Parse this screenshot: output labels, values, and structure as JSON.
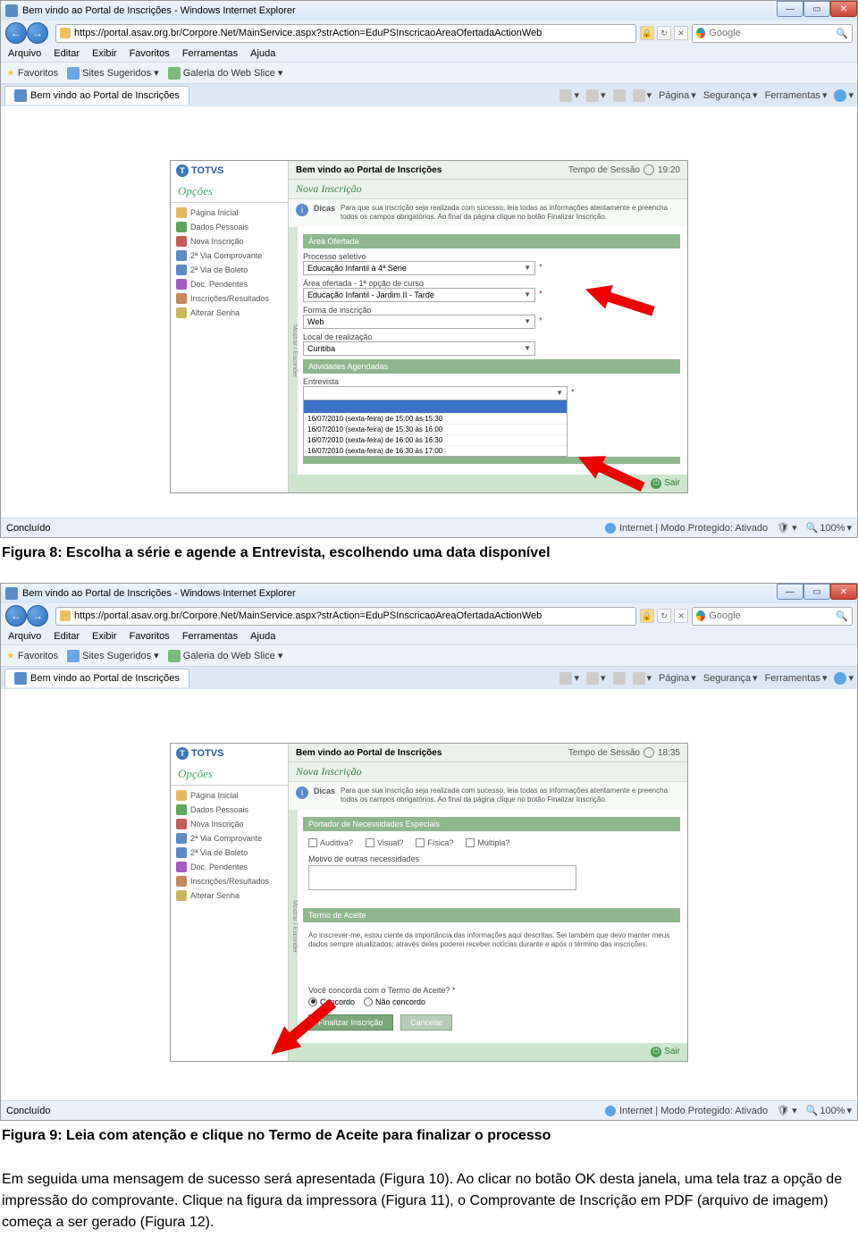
{
  "fig8": {
    "browser": {
      "title": "Bem vindo ao Portal de Inscrições - Windows Internet Explorer",
      "url": "https://portal.asav.org.br/Corpore.Net/MainService.aspx?strAction=EduPSInscricaoAreaOfertadaActionWeb",
      "search_placeholder": "Google",
      "menu": {
        "arquivo": "Arquivo",
        "editar": "Editar",
        "exibir": "Exibir",
        "favoritos": "Favoritos",
        "ferramentas": "Ferramentas",
        "ajuda": "Ajuda"
      },
      "favbar": {
        "favoritos": "Favoritos",
        "sites": "Sites Sugeridos",
        "galeria": "Galeria do Web Slice"
      },
      "tab": "Bem vindo ao Portal de Inscrições",
      "tabright": {
        "pagina": "Página",
        "seguranca": "Segurança",
        "ferramentas": "Ferramentas"
      },
      "status": {
        "left": "Concluído",
        "protected": "Internet | Modo Protegido: Ativado",
        "zoom": "100%"
      }
    },
    "portal": {
      "logo": "TOTVS",
      "header": "Bem vindo ao Portal de Inscrições",
      "tempo": "Tempo de Sessão",
      "time": "19:20",
      "opcoes": "Opções",
      "menu": [
        "Página Inicial",
        "Dados Pessoais",
        "Nova Inscrição",
        "2ª Via Comprovante",
        "2ª Via de Boleto",
        "Doc. Pendentes",
        "Inscrições/Resultados",
        "Alterar Senha"
      ],
      "section_title": "Nova Inscrição",
      "dicas_label": "Dicas",
      "dicas": "Para que sua inscrição seja realizada com sucesso, leia todas as informações atentamente e preencha todos os campos obrigatórios. Ao final da página clique no botão Finalizar Inscrição.",
      "vtab": "Mostrar / Esconder",
      "area_bar": "Área Ofertada",
      "processo_label": "Processo seletivo",
      "processo_value": "Educação Infantil à 4ª Série",
      "area_label": "Área ofertada - 1ª opção de curso",
      "area_value": "Educação Infantil - Jardim II - Tarde",
      "forma_label": "Forma de inscrição",
      "forma_value": "Web",
      "local_label": "Local de realização",
      "local_value": "Curitiba",
      "ativ_bar": "Atividades Agendadas",
      "entrevista_label": "Entrevista",
      "dd_options": [
        "16/07/2010 (sexta-feira) de 15:00 às 15:30",
        "16/07/2010 (sexta-feira) de 15:30 às 16:00",
        "16/07/2010 (sexta-feira) de 16:00 às 16:30",
        "16/07/2010 (sexta-feira) de 16:30 às 17:00"
      ],
      "sair": "Sair"
    },
    "caption": "Figura 8: Escolha a série e agende a Entrevista, escolhendo uma data disponível"
  },
  "fig9": {
    "browser": {
      "title": "Bem vindo ao Portal de Inscrições - Windows Internet Explorer",
      "url": "https://portal.asav.org.br/Corpore.Net/MainService.aspx?strAction=EduPSInscricaoAreaOfertadaActionWeb",
      "search_placeholder": "Google",
      "tab": "Bem vindo ao Portal de Inscrições",
      "status": {
        "left": "Concluído",
        "protected": "Internet | Modo Protegido: Ativado",
        "zoom": "100%"
      }
    },
    "portal": {
      "logo": "TOTVS",
      "header": "Bem vindo ao Portal de Inscrições",
      "tempo": "Tempo de Sessão",
      "time": "18:35",
      "opcoes": "Opções",
      "menu": [
        "Página Inicial",
        "Dados Pessoais",
        "Nova Inscrição",
        "2ª Via Comprovante",
        "2ª Via de Boleto",
        "Doc. Pendentes",
        "Inscrições/Resultados",
        "Alterar Senha"
      ],
      "section_title": "Nova Inscrição",
      "dicas_label": "Dicas",
      "dicas": "Para que sua inscrição seja realizada com sucesso, leia todas as informações atentamente e preencha todos os campos obrigatórios. Ao final da página clique no botão Finalizar Inscrição.",
      "pne_bar": "Portador de Necessidades Especiais",
      "check_auditiva": "Auditiva?",
      "check_visual": "Visual?",
      "check_fisica": "Física?",
      "check_multipla": "Múltipla?",
      "motivo_label": "Motivo de outras necessidades",
      "termo_bar": "Termo de Aceite",
      "termo_text": "Ao inscrever-me, estou ciente da importância das informações aqui descritas. Sei também que devo manter meus dados sempre atualizados; através deles poderei receber notícias durante e após o término das inscrições.",
      "concorda_label": "Você concorda com o Termo de Aceite? *",
      "concordo": "Concordo",
      "nao_concordo": "Não concordo",
      "btn_finalizar": "Finalizar Inscrição",
      "btn_cancelar": "Cancelar",
      "sair": "Sair"
    },
    "caption": "Figura 9: Leia com atenção e clique no Termo de Aceite para finalizar o processo"
  },
  "paragraph": "Em seguida uma mensagem de sucesso será apresentada (Figura 10). Ao clicar no botão OK desta janela, uma tela traz a opção de impressão do comprovante. Clique na figura da impressora (Figura 11), o Comprovante de Inscrição em PDF (arquivo de imagem) começa a ser gerado (Figura 12)."
}
